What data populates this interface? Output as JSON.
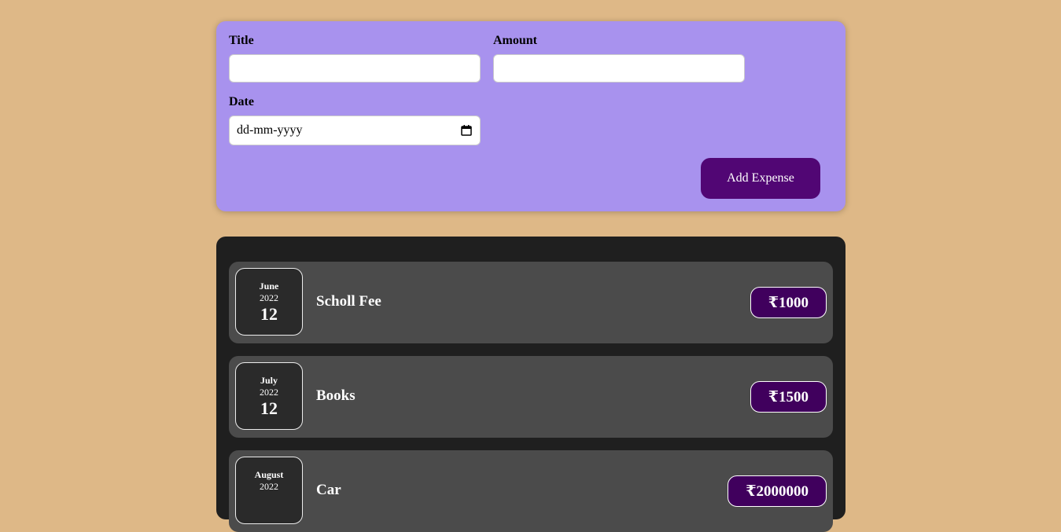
{
  "form": {
    "title_label": "Title",
    "title_value": "",
    "amount_label": "Amount",
    "amount_value": "",
    "date_label": "Date",
    "date_placeholder": "dd-mm-yyyy",
    "submit_label": "Add Expense"
  },
  "expenses": [
    {
      "month": "June",
      "year": "2022",
      "day": "12",
      "title": "Scholl Fee",
      "amount": "₹1000"
    },
    {
      "month": "July",
      "year": "2022",
      "day": "12",
      "title": "Books",
      "amount": "₹1500"
    },
    {
      "month": "August",
      "year": "2022",
      "day": "",
      "title": "Car",
      "amount": "₹2000000"
    }
  ],
  "colors": {
    "page_background": "#deb887",
    "form_background": "#a892ee",
    "button_background": "#510674",
    "list_background": "#1f1f1f",
    "item_background": "#4b4b4b",
    "amount_background": "#40005d"
  },
  "icons": {
    "date_picker": "calendar-icon"
  }
}
